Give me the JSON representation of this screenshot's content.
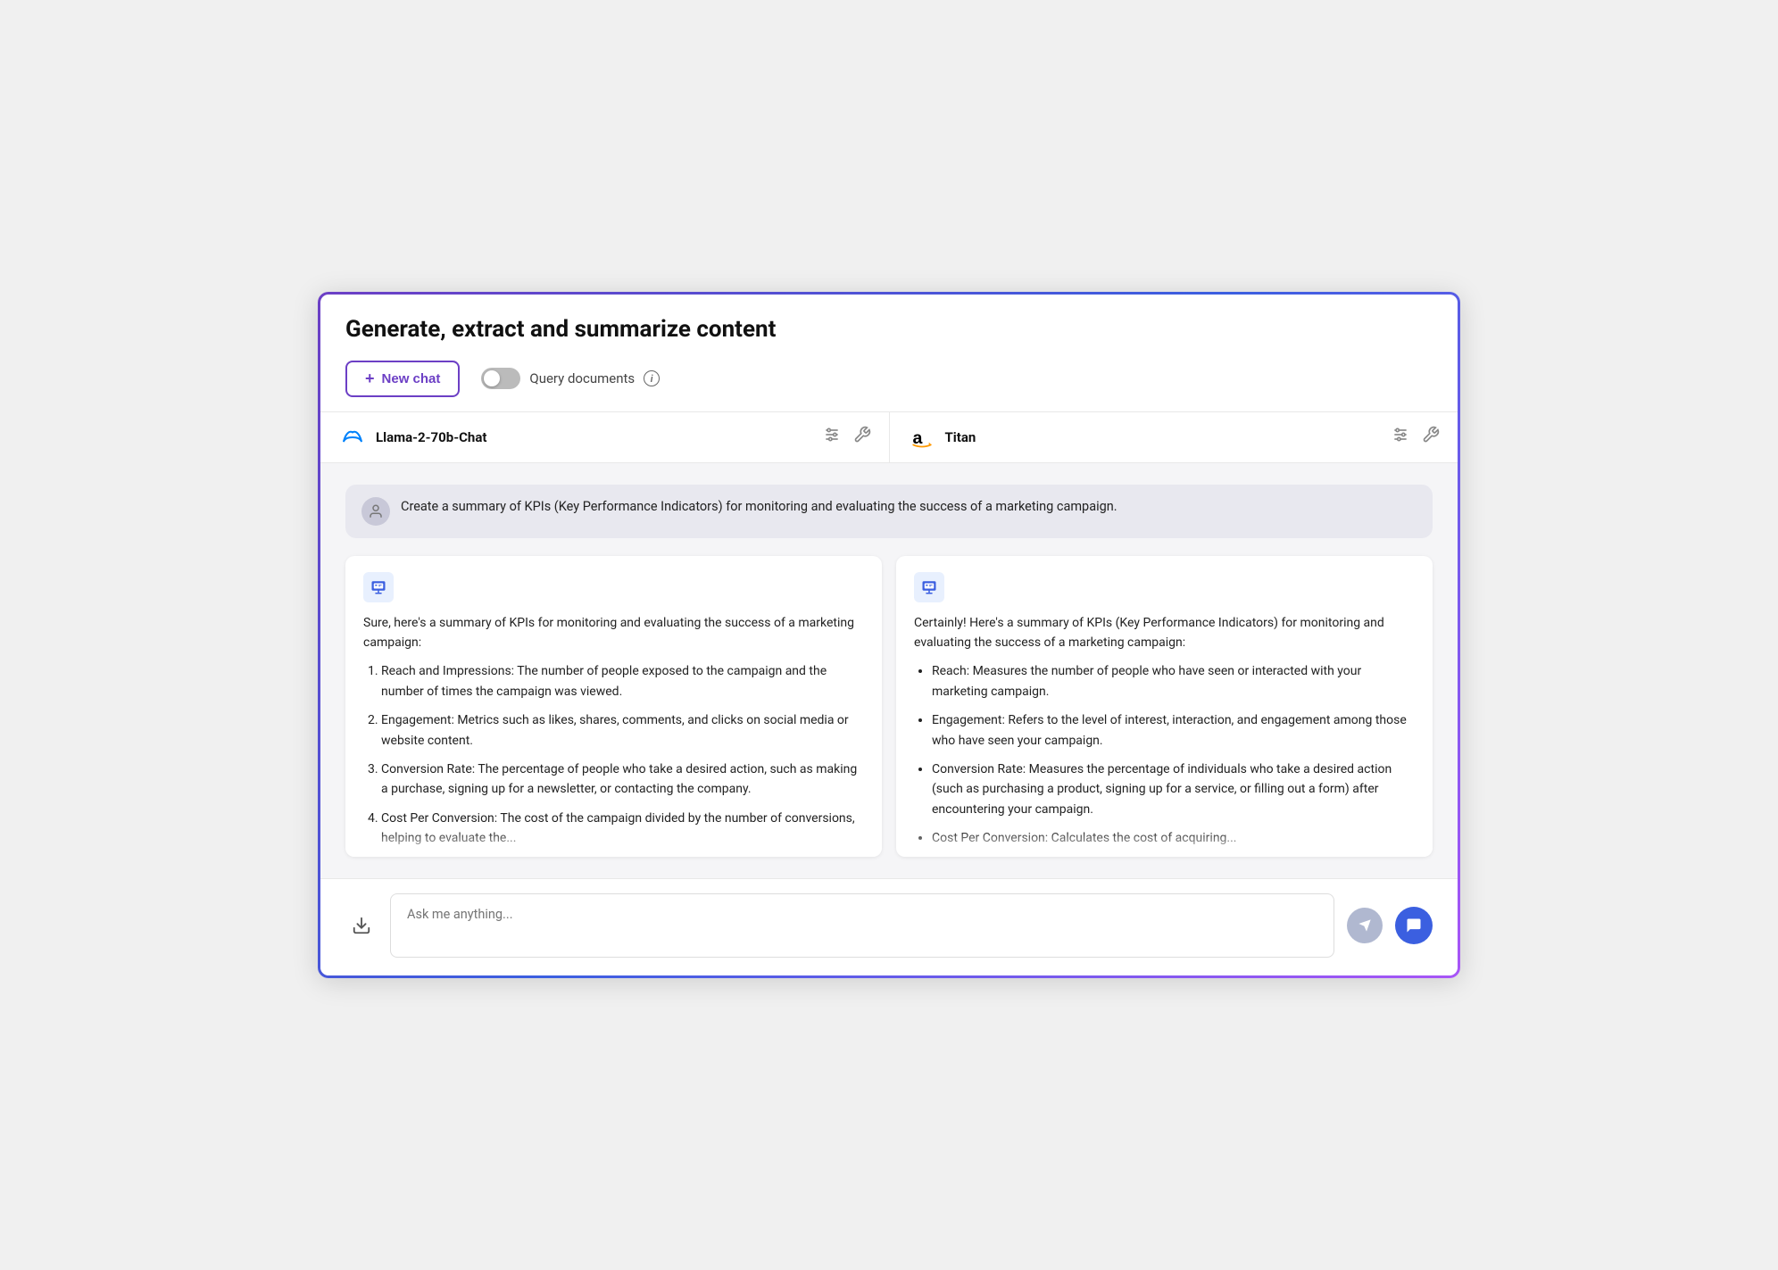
{
  "page": {
    "title": "Generate, extract and summarize content"
  },
  "toolbar": {
    "new_chat_label": "New chat",
    "query_docs_label": "Query documents"
  },
  "models": [
    {
      "id": "llama",
      "name": "Llama-2-70b-Chat",
      "logo_type": "meta"
    },
    {
      "id": "titan",
      "name": "Titan",
      "logo_type": "amazon"
    }
  ],
  "user_message": "Create a summary of KPIs (Key Performance Indicators) for monitoring and evaluating the success of a marketing campaign.",
  "responses": [
    {
      "intro": "Sure, here's a summary of KPIs for monitoring and evaluating the success of a marketing campaign:",
      "items": [
        "Reach and Impressions: The number of people exposed to the campaign and the number of times the campaign was viewed.",
        "Engagement: Metrics such as likes, shares, comments, and clicks on social media or website content.",
        "Conversion Rate: The percentage of people who take a desired action, such as making a purchase, signing up for a newsletter, or contacting the company.",
        "Cost Per Conversion: The cost of the campaign divided by the number of conversions, helping to evaluate the..."
      ],
      "list_type": "ordered"
    },
    {
      "intro": "Certainly! Here's a summary of KPIs (Key Performance Indicators) for monitoring and evaluating the success of a marketing campaign:",
      "items": [
        "Reach: Measures the number of people who have seen or interacted with your marketing campaign.",
        "Engagement: Refers to the level of interest, interaction, and engagement among those who have seen your campaign.",
        "Conversion Rate: Measures the percentage of individuals who take a desired action (such as purchasing a product, signing up for a service, or filling out a form) after encountering your campaign.",
        "Cost Per Conversion: Calculates the cost of acquiring..."
      ],
      "list_type": "bullet"
    }
  ],
  "input": {
    "placeholder": "Ask me anything..."
  },
  "icons": {
    "plus": "+",
    "info": "i",
    "sliders": "⊞",
    "wrench": "🔧",
    "user": "👤",
    "ai_bubble": "💬",
    "download": "⬇",
    "send": "➤",
    "feedback": "💬"
  }
}
